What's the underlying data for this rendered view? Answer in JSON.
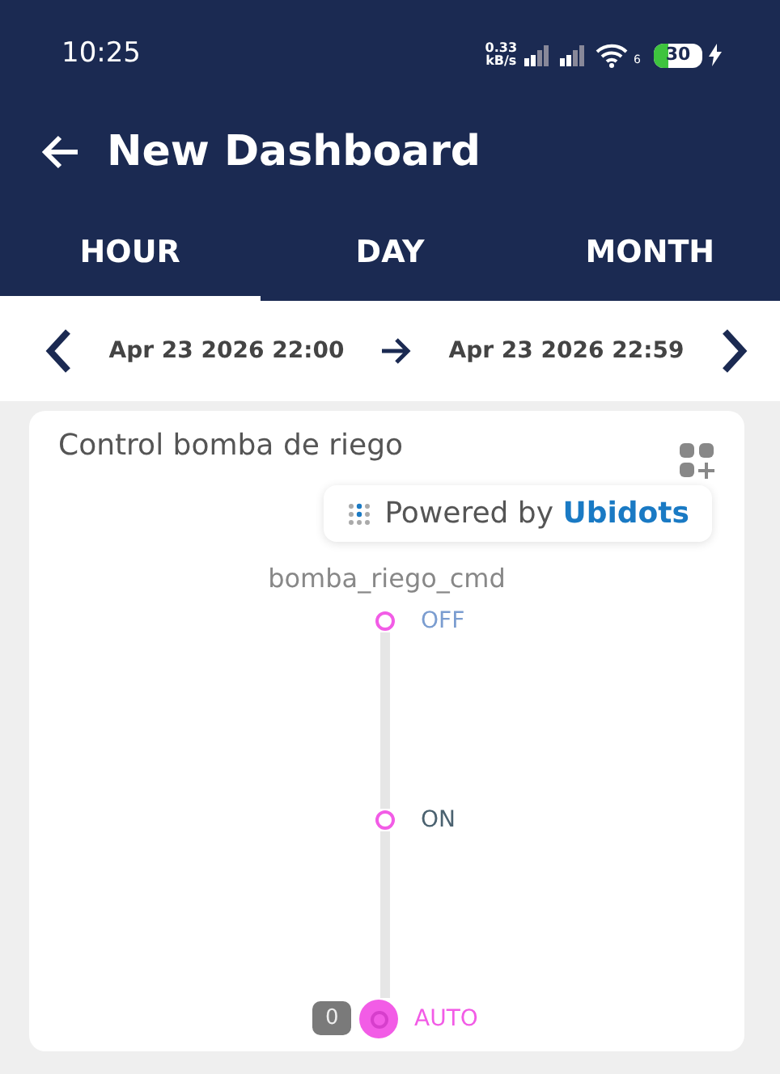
{
  "status_bar": {
    "time": "10:25",
    "speed": "0.33",
    "speed_unit": "kB/s",
    "wifi_label": "6",
    "battery": "30"
  },
  "header": {
    "title": "New Dashboard"
  },
  "tabs": [
    {
      "label": "HOUR",
      "selected": true
    },
    {
      "label": "DAY",
      "selected": false
    },
    {
      "label": "MONTH",
      "selected": false
    }
  ],
  "date_range": {
    "start": "Apr 23 2026 22:00",
    "end": "Apr 23 2026 22:59"
  },
  "widget": {
    "title": "Control bomba de riego",
    "powered_by": "Powered by",
    "brand": "Ubidots",
    "variable": "bomba_riego_cmd",
    "value": "0",
    "options": [
      {
        "label": "OFF",
        "selected": false,
        "color": "#7b9dd0"
      },
      {
        "label": "ON",
        "selected": false,
        "color": "#4b6270"
      },
      {
        "label": "AUTO",
        "selected": true,
        "color": "#f25ce6"
      }
    ]
  }
}
